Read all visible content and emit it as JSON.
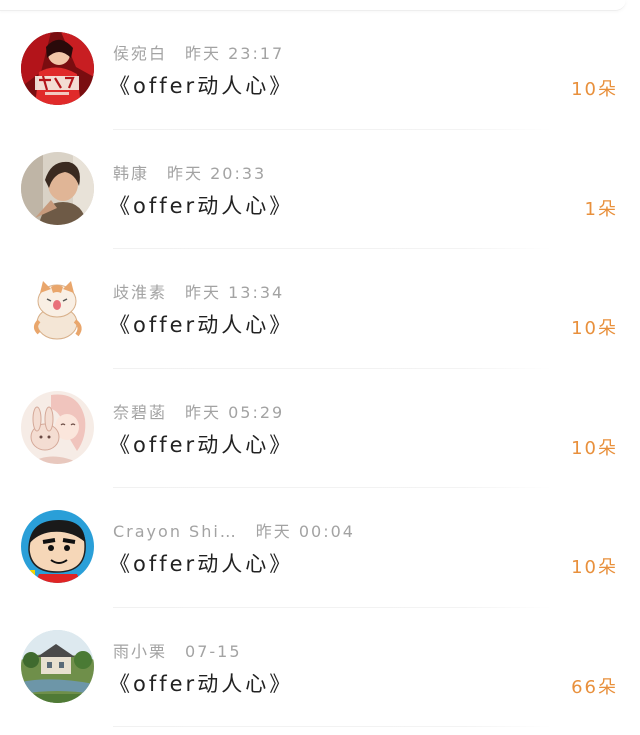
{
  "comments": [
    {
      "name": "侯宛白",
      "time": "昨天 23:17",
      "title": "《offer动人心》",
      "flowers": "10朵",
      "avatar_icon": "red-poster-avatar-icon"
    },
    {
      "name": "韩康",
      "time": "昨天 20:33",
      "title": "《offer动人心》",
      "flowers": "1朵",
      "avatar_icon": "person-photo-avatar-icon"
    },
    {
      "name": "歧淮素",
      "time": "昨天 13:34",
      "title": "《offer动人心》",
      "flowers": "10朵",
      "avatar_icon": "cat-avatar-icon"
    },
    {
      "name": "奈碧菡",
      "time": "昨天 05:29",
      "title": "《offer动人心》",
      "flowers": "10朵",
      "avatar_icon": "girl-rabbit-avatar-icon"
    },
    {
      "name": "Crayon Shi…",
      "time": "昨天 00:04",
      "title": "《offer动人心》",
      "flowers": "10朵",
      "avatar_icon": "crayon-shin-chan-avatar-icon"
    },
    {
      "name": "雨小栗",
      "time": "07-15",
      "title": "《offer动人心》",
      "flowers": "66朵",
      "avatar_icon": "house-landscape-avatar-icon"
    }
  ],
  "colors": {
    "accent": "#e8903c",
    "meta": "#a3a3a3",
    "title": "#222222"
  }
}
